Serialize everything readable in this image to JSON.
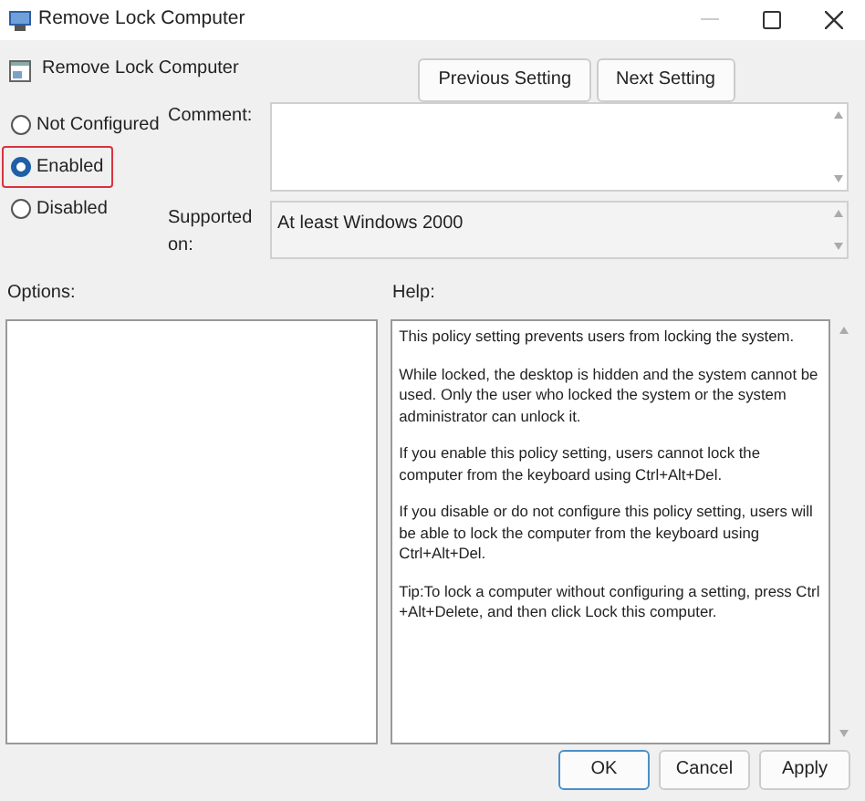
{
  "window": {
    "title": "Remove Lock Computer"
  },
  "policy": {
    "title": "Remove Lock Computer"
  },
  "nav_buttons": [
    {
      "label": "Previous Setting"
    },
    {
      "label": "Next Setting"
    }
  ],
  "state_options": [
    {
      "label": "Not Configured",
      "selected": false,
      "highlighted": false
    },
    {
      "label": "Enabled",
      "selected": true,
      "highlighted": true
    },
    {
      "label": "Disabled",
      "selected": false,
      "highlighted": false
    }
  ],
  "comment": {
    "label": "Comment:"
  },
  "supported_on": {
    "label": "Supported on:",
    "value": "At least Windows 2000"
  },
  "options": {
    "label": "Options:"
  },
  "help": {
    "label": "Help:",
    "paragraphs": [
      "This policy setting prevents users from locking the system.",
      "While locked, the desktop is hidden and the system cannot be used. Only the user who locked the system or the system administrator can unlock it.",
      "If you enable this policy setting, users cannot lock the computer from the keyboard using Ctrl+Alt+Del.",
      "If you disable or do not configure this policy setting, users will be able to lock the computer from the keyboard using Ctrl+Alt+Del.",
      "Tip:To lock a computer without configuring a setting, press Ctrl +Alt+Delete, and then click Lock this computer."
    ]
  },
  "buttons": [
    {
      "label": "OK",
      "default": true
    },
    {
      "label": "Cancel",
      "default": false
    },
    {
      "label": "Apply",
      "default": false
    }
  ]
}
